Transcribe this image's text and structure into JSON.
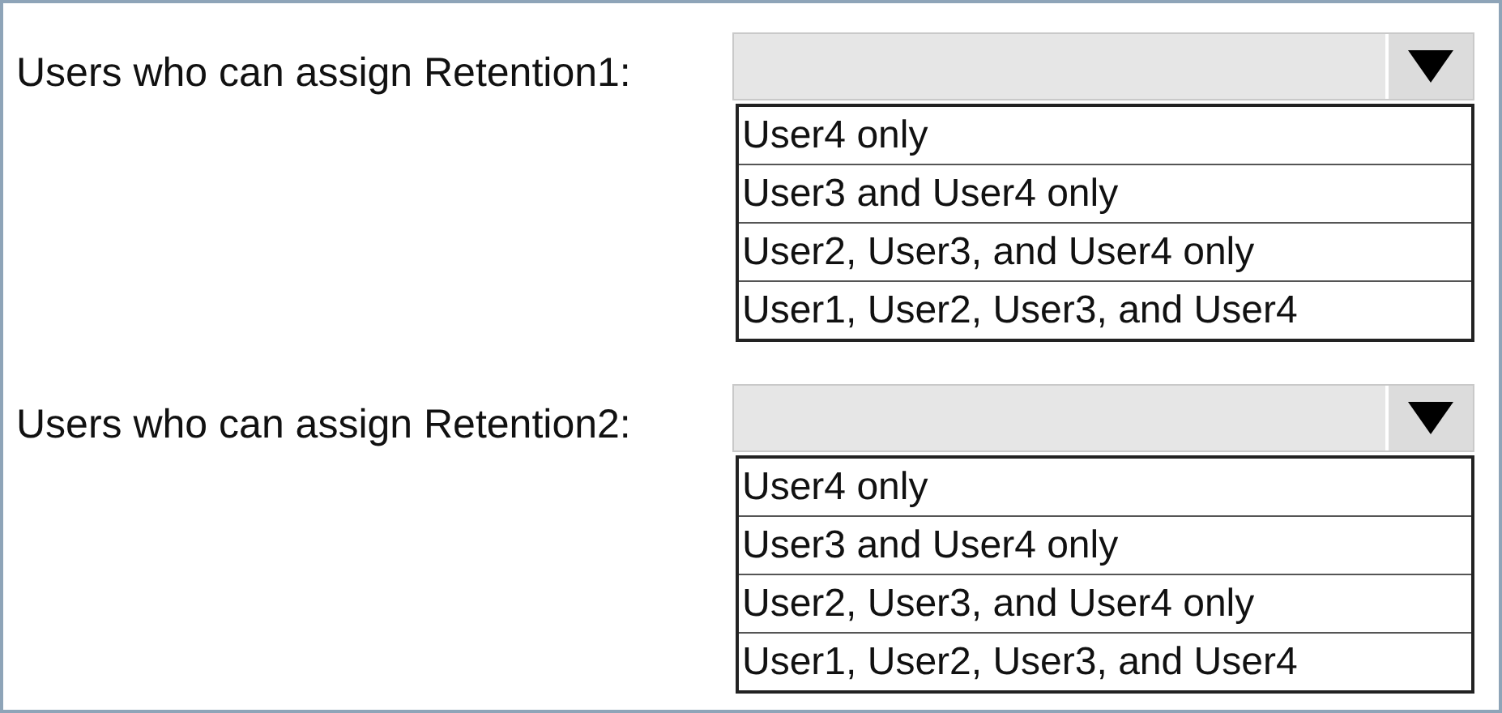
{
  "questions": [
    {
      "label": "Users who can assign Retention1:",
      "options": [
        "User4 only",
        "User3 and User4 only",
        "User2, User3, and User4 only",
        "User1, User2, User3, and User4"
      ]
    },
    {
      "label": "Users who can assign Retention2:",
      "options": [
        "User4 only",
        "User3 and User4 only",
        "User2, User3, and User4 only",
        "User1, User2, User3, and User4"
      ]
    }
  ]
}
